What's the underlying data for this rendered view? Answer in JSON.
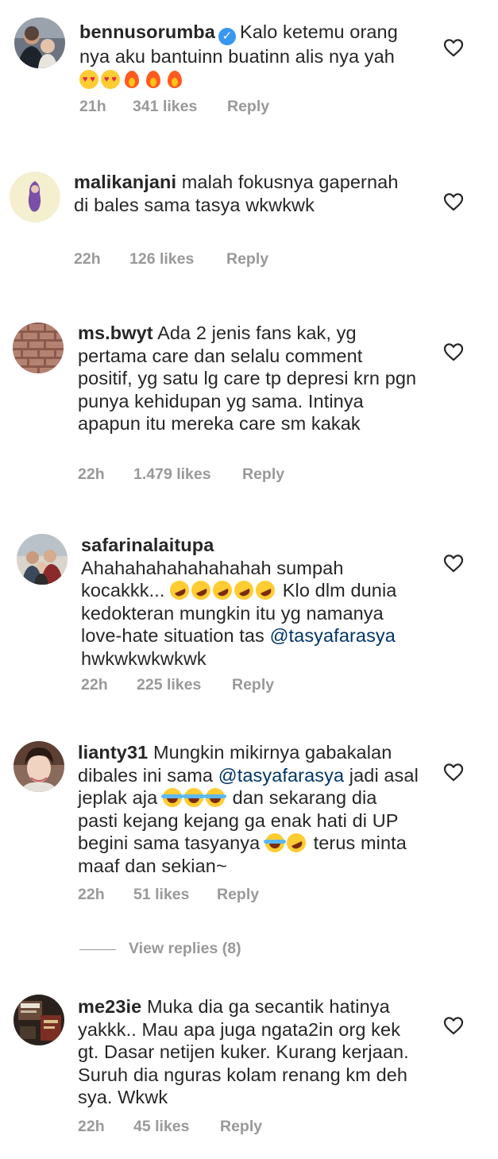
{
  "comments": [
    {
      "username": "bennusorumba",
      "verified": true,
      "text": "Kalo ketemu orang nya aku bantuinn buatinn alis nya yah",
      "time": "21h",
      "likes": "341 likes",
      "reply": "Reply",
      "avatar_icon": "avatar-photo-man-with-child"
    },
    {
      "username": "malikanjani",
      "text": "malah fokusnya gapernah di bales sama tasya wkwkwk",
      "time": "22h",
      "likes": "126 likes",
      "reply": "Reply",
      "avatar_icon": "avatar-illustration-purple-hair"
    },
    {
      "username": "ms.bwyt",
      "text": "Ada 2 jenis fans kak, yg pertama care dan selalu comment positif, yg satu lg care tp depresi krn pgn punya kehidupan yg sama. Intinya apapun itu mereka care sm kakak",
      "time": "22h",
      "likes": "1.479 likes",
      "reply": "Reply",
      "avatar_icon": "avatar-brick-wall"
    },
    {
      "username": "safarinalaitupa",
      "text_part1": "Ahahahahahahahahah sumpah kocakkk...",
      "text_part2": "Klo dlm dunia kedokteran mungkin itu yg namanya love-hate situation tas",
      "mention": "@tasyafarasya",
      "text_part3": "hwkwkwkwkwk",
      "time": "22h",
      "likes": "225 likes",
      "reply": "Reply",
      "avatar_icon": "avatar-group-photo"
    },
    {
      "username": "lianty31",
      "text_part1": "Mungkin mikirnya gabakalan dibales ini sama",
      "mention": "@tasyafarasya",
      "text_part2": "jadi asal jeplak aja",
      "text_part3": "dan sekarang dia pasti kejang kejang ga enak hati di UP begini sama tasyanya",
      "text_part4": "terus minta maaf dan sekian~",
      "time": "22h",
      "likes": "51 likes",
      "reply": "Reply",
      "avatar_icon": "avatar-woman-portrait"
    },
    {
      "username": "me23ie",
      "text": "Muka dia ga secantik hatinya yakkk.. Mau apa juga ngata2in org kek gt. Dasar netijen kuker. Kurang kerjaan. Suruh dia nguras kolam renang km deh sya. Wkwk",
      "time": "22h",
      "likes": "45 likes",
      "reply": "Reply",
      "avatar_icon": "avatar-book-photo"
    }
  ],
  "view_replies": "View replies (8)",
  "colors": {
    "text": "#262626",
    "meta": "#999999",
    "mention": "#003569",
    "verified": "#3897f0"
  }
}
